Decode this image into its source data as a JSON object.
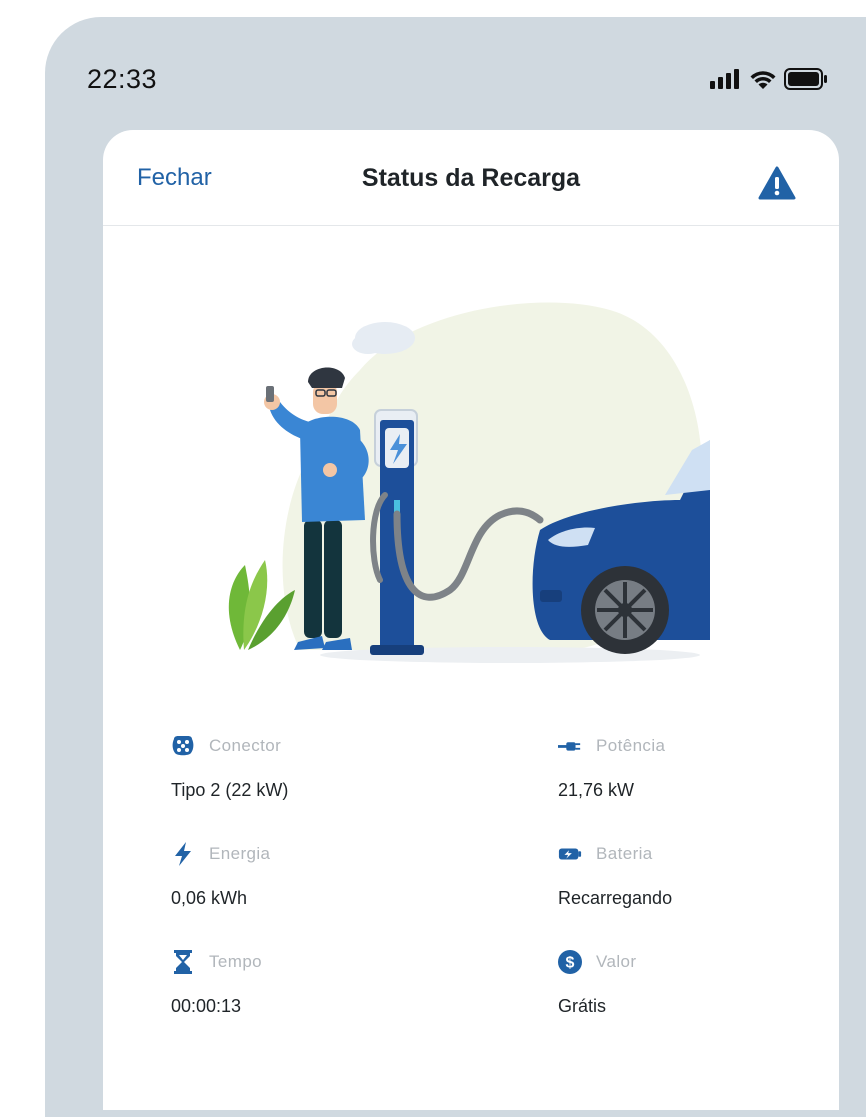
{
  "status_bar": {
    "time": "22:33"
  },
  "header": {
    "close_label": "Fechar",
    "title": "Status da Recarga",
    "alert_icon": "warning-triangle-icon"
  },
  "info": {
    "connector": {
      "label": "Conector",
      "value": "Tipo 2 (22 kW)",
      "icon": "connector-plug-icon"
    },
    "power": {
      "label": "Potência",
      "value": "21,76 kW",
      "icon": "cable-plug-icon"
    },
    "energy": {
      "label": "Energia",
      "value": "0,06 kWh",
      "icon": "lightning-bolt-icon"
    },
    "battery": {
      "label": "Bateria",
      "value": "Recarregando",
      "icon": "battery-charging-icon"
    },
    "time": {
      "label": "Tempo",
      "value": "00:00:13",
      "icon": "hourglass-icon"
    },
    "price": {
      "label": "Valor",
      "value": "Grátis",
      "icon": "dollar-coin-icon"
    }
  },
  "colors": {
    "accent": "#2162a6",
    "background": "#d0d9e0",
    "label": "#b1b6bb"
  }
}
